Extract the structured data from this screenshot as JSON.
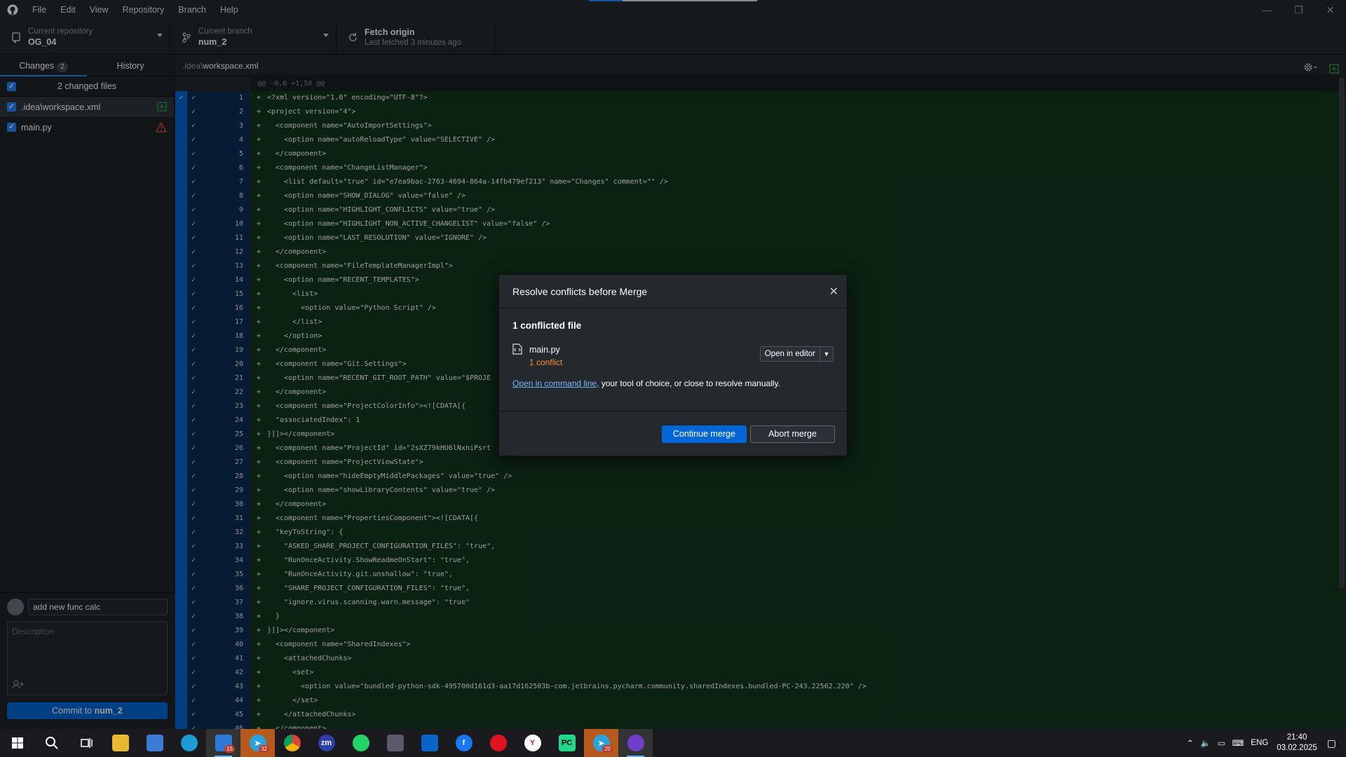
{
  "menu": [
    "File",
    "Edit",
    "View",
    "Repository",
    "Branch",
    "Help"
  ],
  "toolbar": {
    "repo_label": "Current repository",
    "repo_name": "OG_04",
    "branch_label": "Current branch",
    "branch_name": "num_2",
    "fetch_label": "Fetch origin",
    "fetch_sub": "Last fetched 3 minutes ago"
  },
  "tabs": {
    "changes": "Changes",
    "changes_count": "2",
    "history": "History"
  },
  "files": {
    "header": "2 changed files",
    "items": [
      {
        "name": ".idea\\workspace.xml",
        "status": "added"
      },
      {
        "name": "main.py",
        "status": "conflict"
      }
    ]
  },
  "commit": {
    "summary": "add new func calc",
    "description_placeholder": "Description",
    "button_prefix": "Commit to ",
    "button_branch": "num_2"
  },
  "diff": {
    "path_dir": ".idea\\",
    "path_file": "workspace.xml",
    "hunk": "@@ -0,0 +1,58 @@",
    "lines": [
      {
        "n": "1",
        "code": "<?xml version=\"1.0\" encoding=\"UTF-8\"?>"
      },
      {
        "n": "2",
        "code": "<project version=\"4\">"
      },
      {
        "n": "3",
        "code": "  <component name=\"AutoImportSettings\">"
      },
      {
        "n": "4",
        "code": "    <option name=\"autoReloadType\" value=\"SELECTIVE\" />"
      },
      {
        "n": "5",
        "code": "  </component>"
      },
      {
        "n": "6",
        "code": "  <component name=\"ChangeListManager\">"
      },
      {
        "n": "7",
        "code": "    <list default=\"true\" id=\"e7ea9bac-2763-4694-864a-14fb479ef213\" name=\"Changes\" comment=\"\" />"
      },
      {
        "n": "8",
        "code": "    <option name=\"SHOW_DIALOG\" value=\"false\" />"
      },
      {
        "n": "9",
        "code": "    <option name=\"HIGHLIGHT_CONFLICTS\" value=\"true\" />"
      },
      {
        "n": "10",
        "code": "    <option name=\"HIGHLIGHT_NON_ACTIVE_CHANGELIST\" value=\"false\" />"
      },
      {
        "n": "11",
        "code": "    <option name=\"LAST_RESOLUTION\" value=\"IGNORE\" />"
      },
      {
        "n": "12",
        "code": "  </component>"
      },
      {
        "n": "13",
        "code": "  <component name=\"FileTemplateManagerImpl\">"
      },
      {
        "n": "14",
        "code": "    <option name=\"RECENT_TEMPLATES\">"
      },
      {
        "n": "15",
        "code": "      <list>"
      },
      {
        "n": "16",
        "code": "        <option value=\"Python Script\" />"
      },
      {
        "n": "17",
        "code": "      </list>"
      },
      {
        "n": "18",
        "code": "    </option>"
      },
      {
        "n": "19",
        "code": "  </component>"
      },
      {
        "n": "20",
        "code": "  <component name=\"Git.Settings\">"
      },
      {
        "n": "21",
        "code": "    <option name=\"RECENT_GIT_ROOT_PATH\" value=\"$PROJE"
      },
      {
        "n": "22",
        "code": "  </component>"
      },
      {
        "n": "23",
        "code": "  <component name=\"ProjectColorInfo\"><![CDATA[{"
      },
      {
        "n": "24",
        "code": "  \"associatedIndex\": 1"
      },
      {
        "n": "25",
        "code": "}]]></component>"
      },
      {
        "n": "26",
        "code": "  <component name=\"ProjectId\" id=\"2sXZ79kHU6lNxniPsrt"
      },
      {
        "n": "27",
        "code": "  <component name=\"ProjectViewState\">"
      },
      {
        "n": "28",
        "code": "    <option name=\"hideEmptyMiddlePackages\" value=\"true\" />"
      },
      {
        "n": "29",
        "code": "    <option name=\"showLibraryContents\" value=\"true\" />"
      },
      {
        "n": "30",
        "code": "  </component>"
      },
      {
        "n": "31",
        "code": "  <component name=\"PropertiesComponent\"><![CDATA[{"
      },
      {
        "n": "32",
        "code": "  \"keyToString\": {"
      },
      {
        "n": "33",
        "code": "    \"ASKED_SHARE_PROJECT_CONFIGURATION_FILES\": \"true\","
      },
      {
        "n": "34",
        "code": "    \"RunOnceActivity.ShowReadmeOnStart\": \"true\","
      },
      {
        "n": "35",
        "code": "    \"RunOnceActivity.git.unshallow\": \"true\","
      },
      {
        "n": "36",
        "code": "    \"SHARE_PROJECT_CONFIGURATION_FILES\": \"true\","
      },
      {
        "n": "37",
        "code": "    \"ignore.virus.scanning.warn.message\": \"true\""
      },
      {
        "n": "38",
        "code": "  }"
      },
      {
        "n": "39",
        "code": "}]]></component>"
      },
      {
        "n": "40",
        "code": "  <component name=\"SharedIndexes\">"
      },
      {
        "n": "41",
        "code": "    <attachedChunks>"
      },
      {
        "n": "42",
        "code": "      <set>"
      },
      {
        "n": "43",
        "code": "        <option value=\"bundled-python-sdk-495700d161d3-aa17d162503b-com.jetbrains.pycharm.community.sharedIndexes.bundled-PC-243.22562.220\" />"
      },
      {
        "n": "44",
        "code": "      </set>"
      },
      {
        "n": "45",
        "code": "    </attachedChunks>"
      },
      {
        "n": "46",
        "code": "  </component>"
      }
    ]
  },
  "dialog": {
    "title": "Resolve conflicts before Merge",
    "count": "1 conflicted file",
    "file": "main.py",
    "file_status": "1 conflict",
    "open_editor": "Open in editor",
    "help_link": "Open in command line,",
    "help_rest": " your tool of choice, or close to resolve manually.",
    "continue": "Continue merge",
    "abort": "Abort merge"
  },
  "taskbar": {
    "lang": "ENG",
    "time": "21:40",
    "date": "03.02.2025",
    "badge_mail": "15",
    "badge_tg1": "32",
    "badge_tg2": "20"
  },
  "colors": {
    "accent": "#0366d6",
    "conflict": "#ff8c2b",
    "added_bg": "#12361e"
  }
}
